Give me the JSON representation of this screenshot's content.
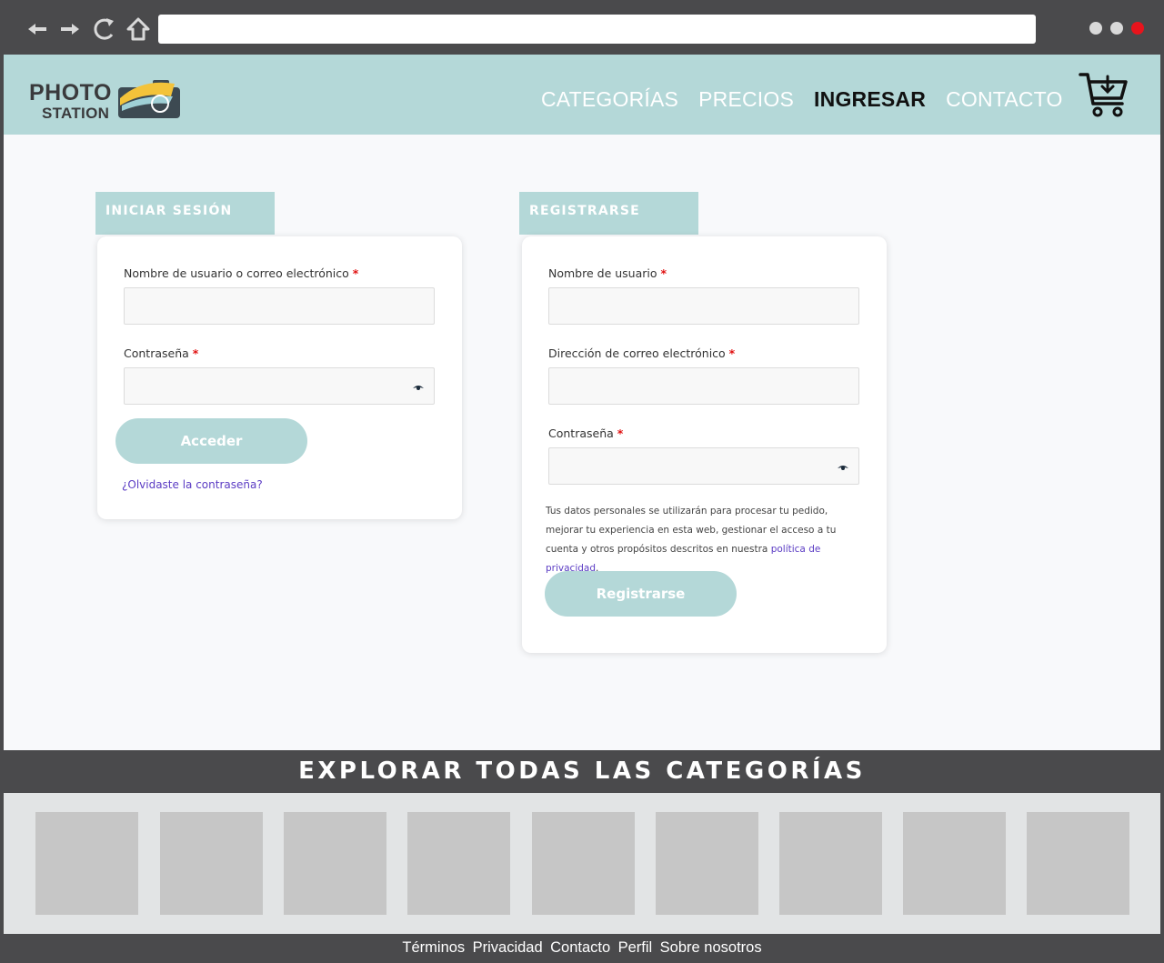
{
  "browser": {
    "nav_icons": [
      "back-arrow-icon",
      "forward-arrow-icon",
      "reload-icon",
      "home-icon"
    ],
    "window_dot_colors": [
      "#d9d9d9",
      "#d9d9d9",
      "#e8141c"
    ]
  },
  "header": {
    "logo_line1": "PHOTO",
    "logo_line2": "STATION",
    "nav": [
      {
        "label": "CATEGORÍAS",
        "active": false
      },
      {
        "label": "PRECIOS",
        "active": false
      },
      {
        "label": "INGRESAR",
        "active": true
      },
      {
        "label": "CONTACTO",
        "active": false
      }
    ],
    "cart_icon": "cart-icon"
  },
  "login": {
    "tab": "INICIAR SESIÓN",
    "username_label": "Nombre de usuario o correo electrónico",
    "password_label": "Contraseña",
    "required_mark": "*",
    "submit": "Acceder",
    "forgot": "¿Olvidaste la contraseña?"
  },
  "register": {
    "tab": "REGISTRARSE",
    "username_label": "Nombre de usuario",
    "email_label": "Dirección de correo electrónico",
    "password_label": "Contraseña",
    "required_mark": "*",
    "privacy_text": "Tus datos personales se utilizarán para procesar tu pedido, mejorar tu experiencia en esta web, gestionar el acceso a tu cuenta y otros propósitos descritos en nuestra",
    "privacy_link": "política de privacidad",
    "privacy_end": ".",
    "submit": "Registrarse"
  },
  "explore": {
    "title": "EXPLORAR TODAS LAS CATEGORÍAS",
    "thumb_count": 9
  },
  "footer": {
    "links": [
      "Términos",
      "Privacidad",
      "Contacto",
      "Perfil",
      "Sobre nosotros"
    ]
  },
  "colors": {
    "accent": "#b4d8d8",
    "chrome": "#4a4a4c",
    "link": "#5b3cc4",
    "required": "#e01010"
  }
}
